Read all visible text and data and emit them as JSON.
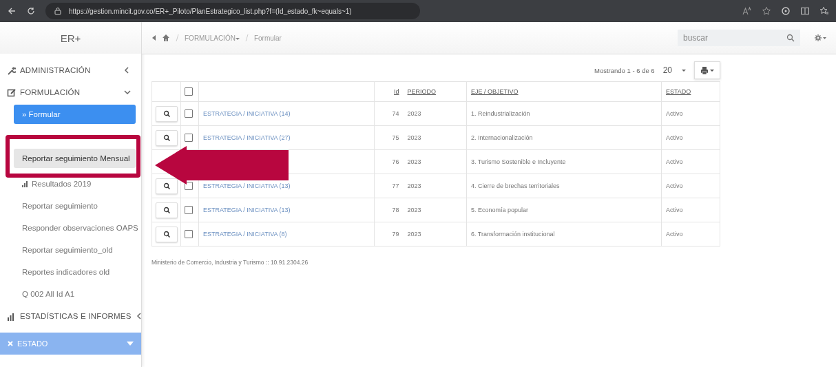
{
  "browser": {
    "url": "https://gestion.mincit.gov.co/ER+_Piloto/PlanEstrategico_list.php?f=(Id_estado_fk~equals~1)"
  },
  "sidebar": {
    "brand": "ER+",
    "items": [
      {
        "kind": "section",
        "label": "ADMINISTRACIÓN",
        "expanded": false
      },
      {
        "kind": "section",
        "label": "FORMULACIÓN",
        "expanded": true
      },
      {
        "kind": "link",
        "label": "» Formular",
        "selected": true,
        "highlighted": false
      },
      {
        "kind": "link",
        "label": "Reportar seguimiento Mensual",
        "selected": false,
        "highlighted": true
      },
      {
        "kind": "stat-link",
        "label": "Resultados 2019",
        "selected": false,
        "highlighted": false
      },
      {
        "kind": "link",
        "label": "Reportar seguimiento",
        "selected": false,
        "highlighted": false
      },
      {
        "kind": "link",
        "label": "Responder observaciones OAPS",
        "selected": false,
        "highlighted": false
      },
      {
        "kind": "link",
        "label": "Reportar seguimiento_old",
        "selected": false,
        "highlighted": false
      },
      {
        "kind": "link",
        "label": "Reportes indicadores old",
        "selected": false,
        "highlighted": false
      },
      {
        "kind": "link",
        "label": "Q 002 All Id A1",
        "selected": false,
        "highlighted": false
      },
      {
        "kind": "section",
        "label": "ESTADÍSTICAS E INFORMES",
        "expanded": false
      }
    ],
    "panel": {
      "label": "ESTADO"
    }
  },
  "header": {
    "breadcrumb": [
      "FORMULACIÓN",
      "Formular"
    ],
    "search": {
      "placeholder": "buscar"
    }
  },
  "pager": {
    "text": "Mostrando 1 - 6 de 6",
    "page_size": "20"
  },
  "table": {
    "header_checked": false,
    "columns": [
      "Id",
      "PERIODO",
      "EJE / OBJETIVO",
      "ESTADO"
    ],
    "rows": [
      {
        "link": "ESTRATEGIA / INICIATIVA (14)",
        "checked": false,
        "id": "74",
        "periodo": "2023",
        "eje": "1. Reindustrialización",
        "estado": "Activo"
      },
      {
        "link": "ESTRATEGIA / INICIATIVA (27)",
        "checked": false,
        "id": "75",
        "periodo": "2023",
        "eje": "2. Internacionalización",
        "estado": "Activo"
      },
      {
        "id": "76",
        "periodo": "2023",
        "eje": "3. Turismo Sostenible e Incluyente",
        "estado": "Activo"
      },
      {
        "link": "ESTRATEGIA / INICIATIVA (13)",
        "checked": false,
        "id": "77",
        "periodo": "2023",
        "eje": "4. Cierre de brechas territoriales",
        "estado": "Activo"
      },
      {
        "link": "ESTRATEGIA / INICIATIVA (13)",
        "checked": false,
        "id": "78",
        "periodo": "2023",
        "eje": "5. Economía popular",
        "estado": "Activo"
      },
      {
        "link": "ESTRATEGIA / INICIATIVA (8)",
        "checked": false,
        "id": "79",
        "periodo": "2023",
        "eje": "6. Transformación institucional",
        "estado": "Activo"
      }
    ]
  },
  "footer": "Ministerio de Comercio, Industria y Turismo :: 10.91.2304.26"
}
